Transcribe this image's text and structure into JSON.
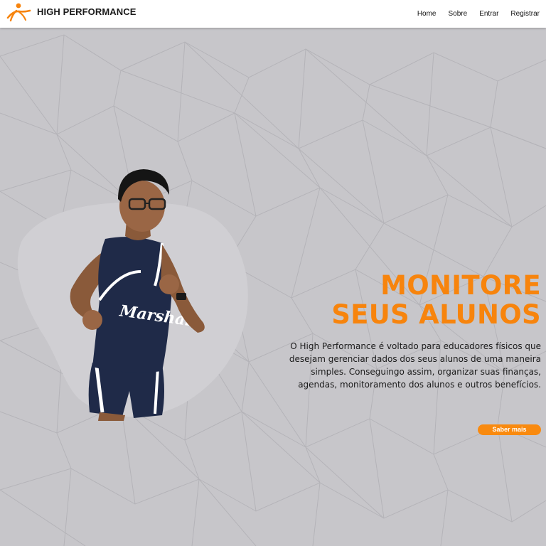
{
  "header": {
    "brand": "HIGH PERFORMANCE",
    "nav": [
      "Home",
      "Sobre",
      "Entrar",
      "Registrar"
    ]
  },
  "hero": {
    "headline_line1": "MONITORE",
    "headline_line2": "SEUS ALUNOS",
    "description": "O High Performance é voltado para educadores físicos que desejam gerenciar dados dos seus alunos de uma maneira simples. Conseguingo assim, organizar suas finanças, agendas, monitoramento dos alunos e outros benefícios.",
    "cta_label": "Saber mais",
    "runner_shirt_text": "Marshall"
  },
  "colors": {
    "accent": "#f7840d",
    "background": "#c7c6ca",
    "navbar": "#ffffff",
    "jersey": "#1f2a48"
  },
  "icons": {
    "logo": "running-person-icon"
  }
}
